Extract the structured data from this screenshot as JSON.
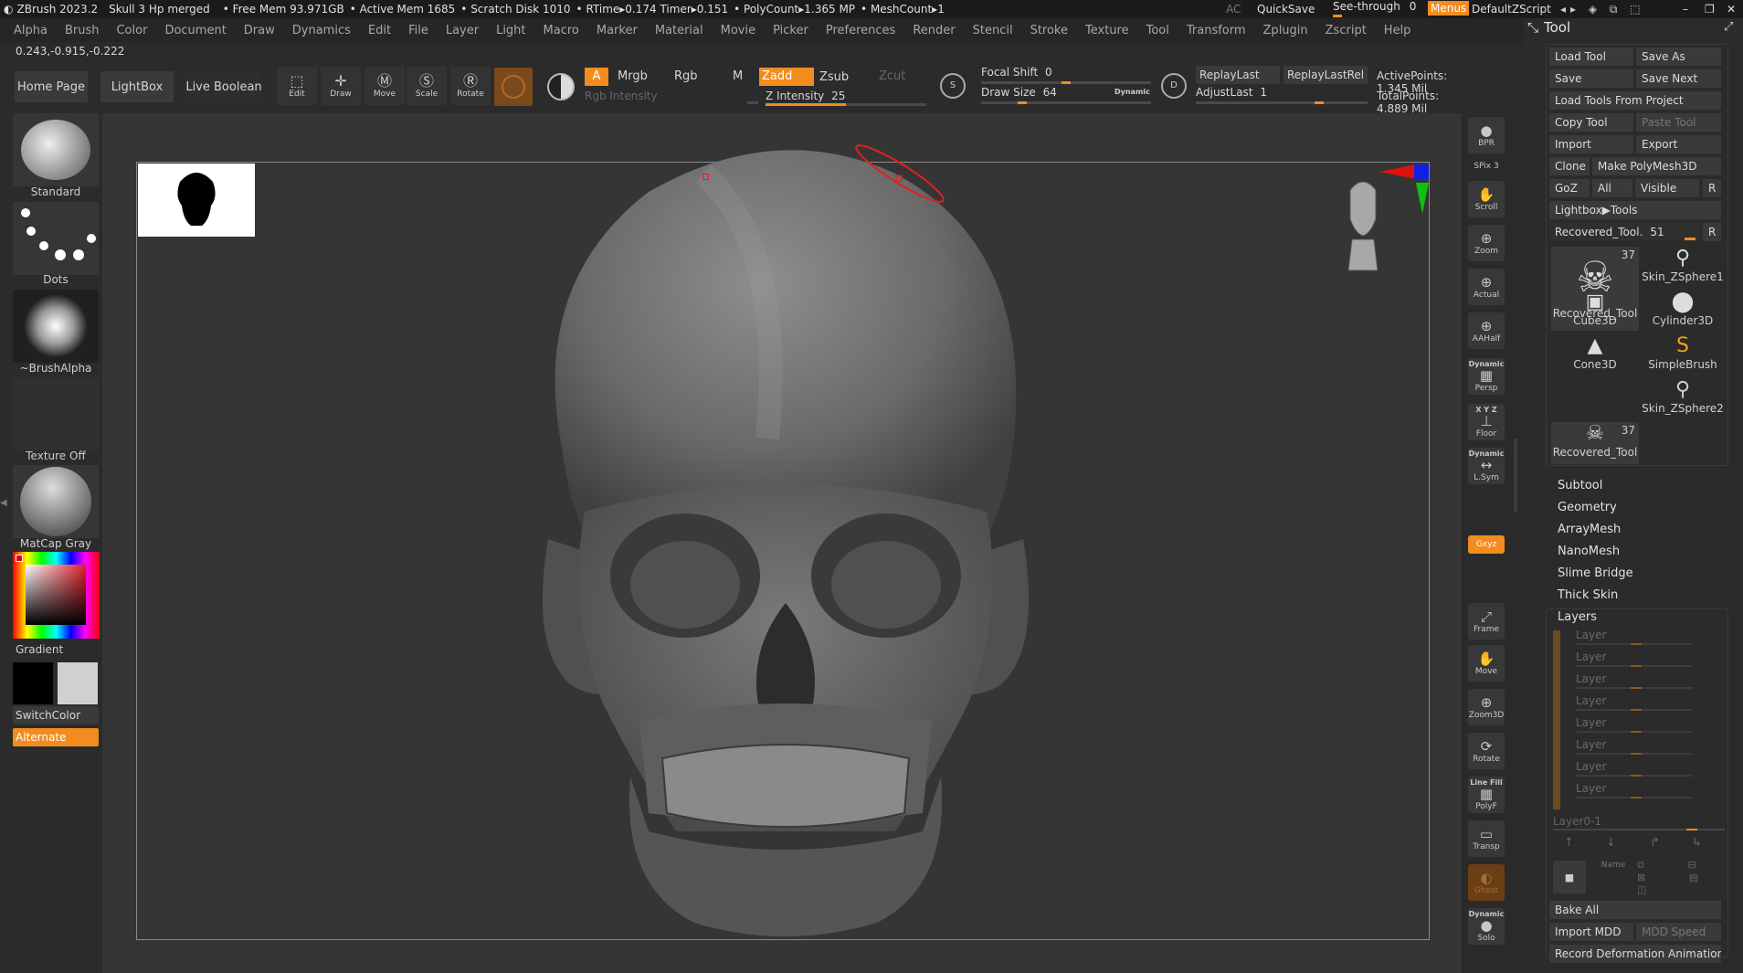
{
  "titlebar": {
    "app": "ZBrush 2023.2",
    "project": "Skull 3 Hp merged",
    "free_mem": "• Free Mem 93.971GB",
    "active_mem": "• Active Mem 1685",
    "scratch": "• Scratch Disk 1010",
    "rtime": "• RTime▸0.174 Timer▸0.151",
    "polycount": "• PolyCount▸1.365 MP",
    "meshcount": "• MeshCount▸1",
    "ac": "AC",
    "quicksave": "QuickSave",
    "see_through": "See-through",
    "see_through_value": "0",
    "menus": "Menus",
    "script": "DefaultZScript"
  },
  "menu": [
    "Alpha",
    "Brush",
    "Color",
    "Document",
    "Draw",
    "Dynamics",
    "Edit",
    "File",
    "Layer",
    "Light",
    "Macro",
    "Marker",
    "Material",
    "Movie",
    "Picker",
    "Preferences",
    "Render",
    "Stencil",
    "Stroke",
    "Texture",
    "Tool",
    "Transform",
    "Zplugin",
    "Zscript",
    "Help"
  ],
  "coords": "0.243,-0.915,-0.222",
  "shelf": {
    "home": "Home Page",
    "lightbox": "LightBox",
    "live_boolean": "Live Boolean",
    "edit": "Edit",
    "draw": "Draw",
    "move": "Move",
    "scale": "Scale",
    "rotate": "Rotate",
    "a": "A",
    "mrgb": "Mrgb",
    "rgb": "Rgb",
    "m": "M",
    "zadd": "Zadd",
    "zsub": "Zsub",
    "zcut": "Zcut",
    "rgb_intensity": "Rgb Intensity",
    "z_intensity": "Z Intensity",
    "z_intensity_value": "25",
    "focal_shift": "Focal Shift",
    "focal_shift_value": "0",
    "draw_size": "Draw Size",
    "draw_size_value": "64",
    "dynamic": "Dynamic",
    "replay_last": "ReplayLast",
    "replay_last_rel": "ReplayLastRel",
    "adjust_last": "AdjustLast",
    "adjust_last_value": "1",
    "active_points": "ActivePoints: 1.345 Mil",
    "total_points": "TotalPoints: 4.889 Mil"
  },
  "left": {
    "brush": "Standard",
    "stroke": "Dots",
    "alpha": "~BrushAlpha",
    "texture": "Texture Off",
    "material": "MatCap Gray",
    "gradient": "Gradient",
    "switch_color": "SwitchColor",
    "alternate": "Alternate"
  },
  "right_strip": [
    {
      "label": "BPR"
    },
    {
      "label": "SPix 3"
    },
    {
      "label": "Scroll"
    },
    {
      "label": "Zoom"
    },
    {
      "label": "Actual"
    },
    {
      "label": "AAHalf"
    },
    {
      "label": "Persp",
      "top": "Dynamic"
    },
    {
      "label": "Floor",
      "top": "X Y Z"
    },
    {
      "label": "L.Sym",
      "top": "Dynamic"
    },
    {
      "label": "Gxyz"
    },
    {
      "label": "Frame"
    },
    {
      "label": "Move"
    },
    {
      "label": "Zoom3D"
    },
    {
      "label": "Rotate"
    },
    {
      "label": "PolyF",
      "top": "Line Fill"
    },
    {
      "label": "Transp"
    },
    {
      "label": "Ghost"
    },
    {
      "label": "Solo",
      "top": "Dynamic"
    }
  ],
  "tool": {
    "title": "Tool",
    "load_tool": "Load Tool",
    "save_as": "Save As",
    "save": "Save",
    "save_next": "Save Next",
    "load_from_project": "Load Tools From Project",
    "copy_tool": "Copy Tool",
    "paste_tool": "Paste Tool",
    "import": "Import",
    "export": "Export",
    "clone": "Clone",
    "make_polymesh": "Make PolyMesh3D",
    "goz": "GoZ",
    "all": "All",
    "visible": "Visible",
    "r": "R",
    "lightbox_tools": "Lightbox▶Tools",
    "current_tool": "Recovered_Tool.",
    "current_tool_value": "51",
    "items": [
      {
        "name": "Recovered_Tool",
        "count": "37"
      },
      {
        "name": "Skin_ZSphere1",
        "count": ""
      },
      {
        "name": "Cube3D",
        "count": ""
      },
      {
        "name": "Cylinder3D",
        "count": ""
      },
      {
        "name": "Cone3D",
        "count": ""
      },
      {
        "name": "SimpleBrush",
        "count": ""
      },
      {
        "name": "Skin_ZSphere2",
        "count": ""
      },
      {
        "name": "Recovered_Tool",
        "count": "37"
      }
    ],
    "sections": [
      "Subtool",
      "Geometry",
      "ArrayMesh",
      "NanoMesh",
      "Slime Bridge",
      "Thick Skin"
    ],
    "layers_title": "Layers",
    "layer_label": "Layer",
    "layer_count": 8,
    "layer_footer": "Layer0-1",
    "name_btn": "Name",
    "bake_all": "Bake All",
    "import_mdd": "Import MDD",
    "mdd_speed": "MDD Speed",
    "record_anim": "Record Deformation Animation"
  }
}
